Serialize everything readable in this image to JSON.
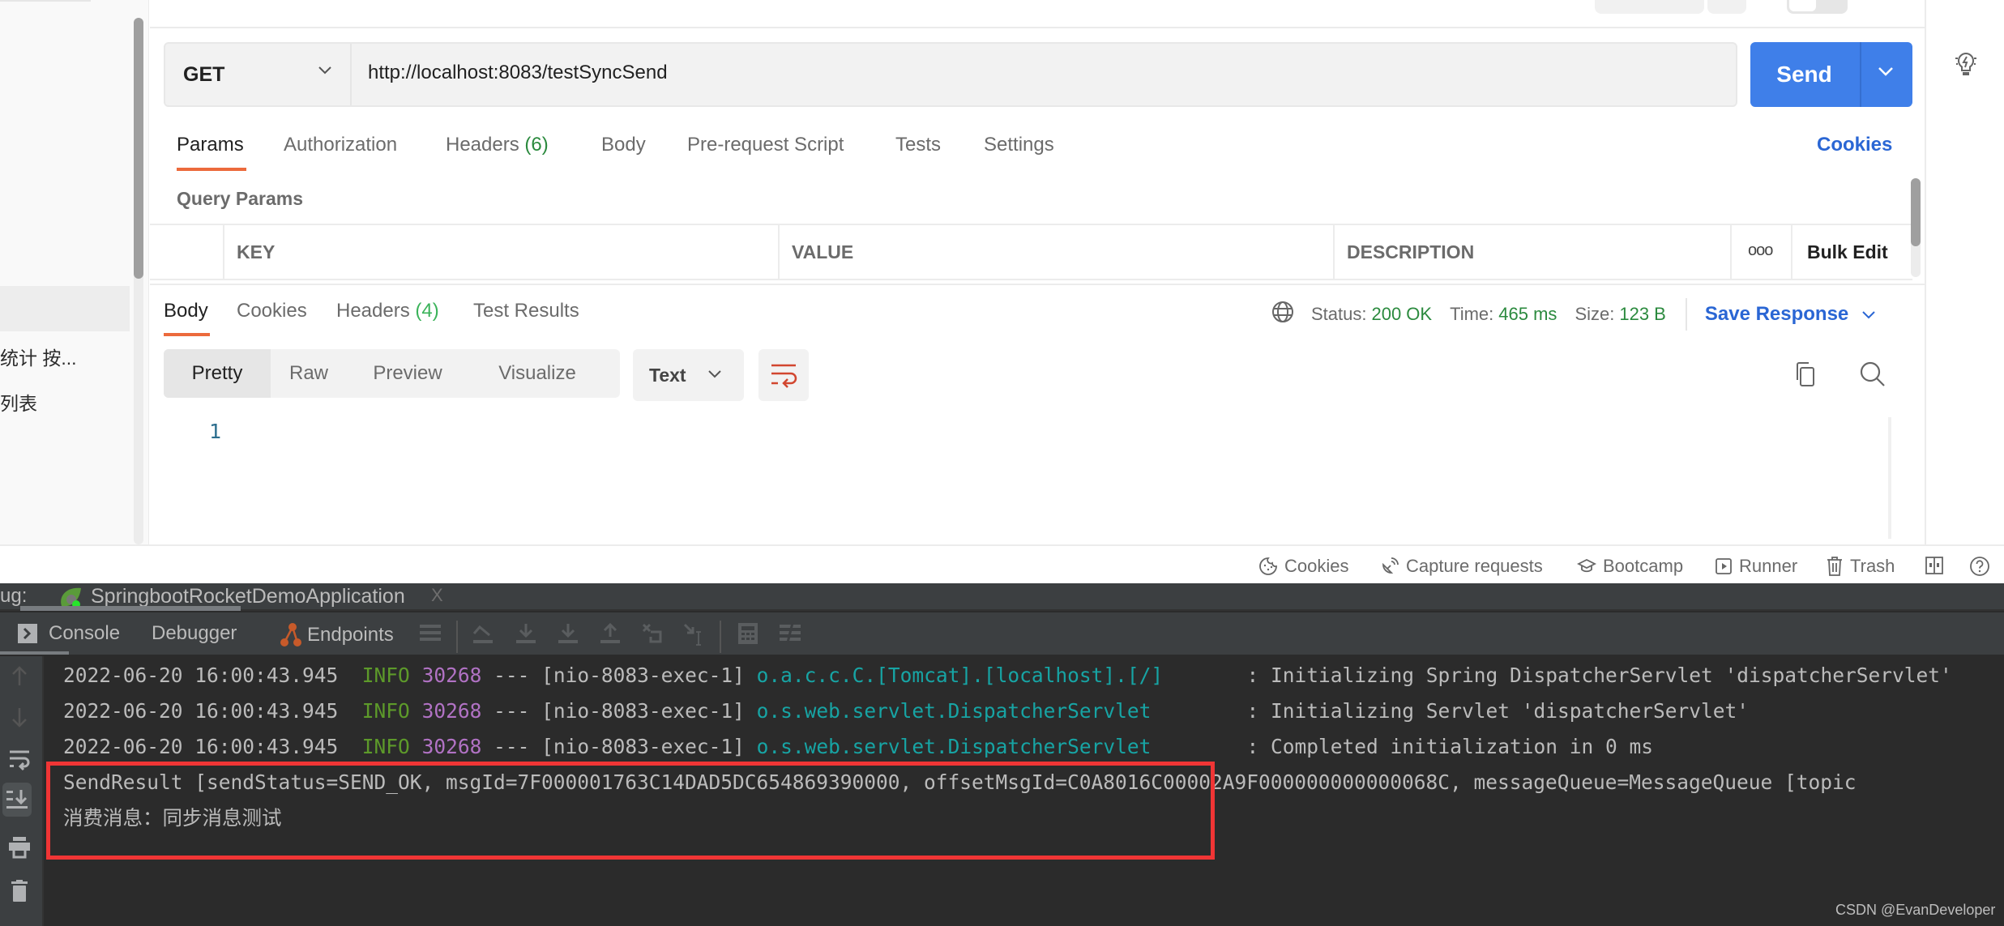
{
  "sidebar": {
    "items": [
      {
        "label": "统计 按..."
      },
      {
        "label": "列表"
      }
    ]
  },
  "request": {
    "method": "GET",
    "url": "http://localhost:8083/testSyncSend",
    "send_label": "Send",
    "tabs": [
      {
        "label": "Params",
        "count": ""
      },
      {
        "label": "Authorization",
        "count": ""
      },
      {
        "label": "Headers",
        "count": "(6)"
      },
      {
        "label": "Body",
        "count": ""
      },
      {
        "label": "Pre-request Script",
        "count": ""
      },
      {
        "label": "Tests",
        "count": ""
      },
      {
        "label": "Settings",
        "count": ""
      }
    ],
    "active_tab": "Params",
    "cookies_link": "Cookies",
    "query_params_title": "Query Params",
    "table_headers": {
      "key": "KEY",
      "value": "VALUE",
      "description": "DESCRIPTION",
      "more": "ooo",
      "bulk_edit": "Bulk Edit"
    }
  },
  "response": {
    "tabs": [
      {
        "label": "Body",
        "count": ""
      },
      {
        "label": "Cookies",
        "count": ""
      },
      {
        "label": "Headers",
        "count": "(4)"
      },
      {
        "label": "Test Results",
        "count": ""
      }
    ],
    "active_tab": "Body",
    "status_label": "Status:",
    "status_value": "200 OK",
    "time_label": "Time:",
    "time_value": "465 ms",
    "size_label": "Size:",
    "size_value": "123 B",
    "save_response": "Save Response",
    "view_modes": [
      "Pretty",
      "Raw",
      "Preview",
      "Visualize"
    ],
    "active_view": "Pretty",
    "format": "Text",
    "line_numbers": [
      "1"
    ],
    "status_color": "#2b8a3e"
  },
  "statusbar": {
    "items": [
      "Cookies",
      "Capture requests",
      "Bootcamp",
      "Runner",
      "Trash"
    ]
  },
  "ide": {
    "debug_label": "ug:",
    "run_config": "SpringbootRocketDemoApplication",
    "close_glyph": "X",
    "tabs": [
      "Console",
      "Debugger",
      "Endpoints"
    ],
    "active_tab": "Console",
    "log_lines": [
      {
        "timestamp": "2022-06-20 16:00:43.945",
        "level": "INFO",
        "pid": "30268",
        "sep": "---",
        "thread": "[nio-8083-exec-1]",
        "logger": "o.a.c.c.C.[Tomcat].[localhost].[/]",
        "message": ": Initializing Spring DispatcherServlet 'dispatcherServlet'"
      },
      {
        "timestamp": "2022-06-20 16:00:43.945",
        "level": "INFO",
        "pid": "30268",
        "sep": "---",
        "thread": "[nio-8083-exec-1]",
        "logger": "o.s.web.servlet.DispatcherServlet",
        "message": ": Initializing Servlet 'dispatcherServlet'"
      },
      {
        "timestamp": "2022-06-20 16:00:43.945",
        "level": "INFO",
        "pid": "30268",
        "sep": "---",
        "thread": "[nio-8083-exec-1]",
        "logger": "o.s.web.servlet.DispatcherServlet",
        "message": ": Completed initialization in 0 ms"
      }
    ],
    "output_lines": [
      "SendResult [sendStatus=SEND_OK, msgId=7F000001763C14DAD5DC654869390000, offsetMsgId=C0A8016C00002A9F000000000000068C, messageQueue=MessageQueue [topic",
      "消费消息：同步消息测试"
    ],
    "colors": {
      "info": "#5d9a2a",
      "pid": "#b172c4",
      "logger": "#17a4a4",
      "highlight": "#f03535"
    }
  },
  "watermark": "CSDN @EvanDeveloper"
}
